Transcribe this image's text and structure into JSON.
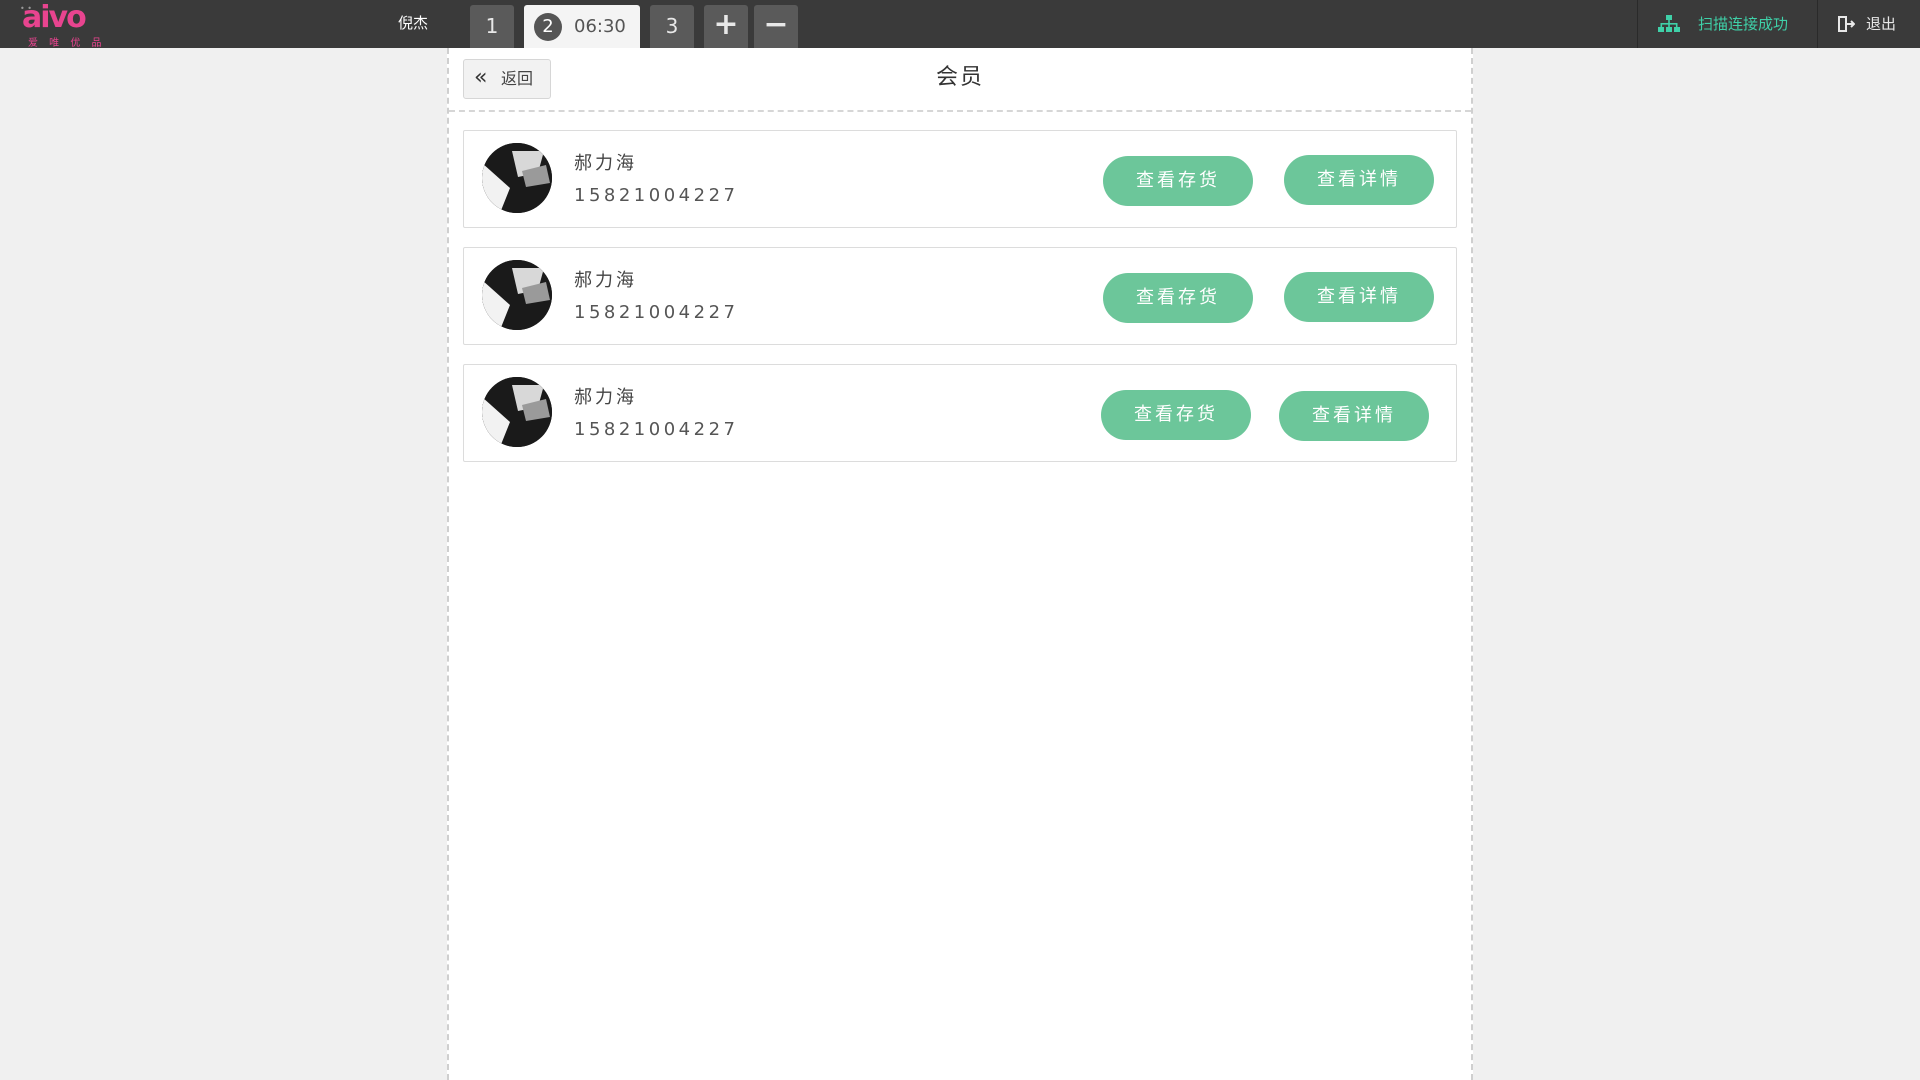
{
  "topbar": {
    "logo_text": "aivo",
    "logo_sub": "爱 唯 优 品",
    "username": "倪杰",
    "tabs": [
      {
        "label": "1"
      },
      {
        "label": "2",
        "time": "06:30"
      },
      {
        "label": "3"
      }
    ],
    "add_label": "+",
    "remove_label": "−",
    "scan_status": "扫描连接成功",
    "logout_label": "退出"
  },
  "page": {
    "back_label": "返回",
    "title": "会员"
  },
  "members": [
    {
      "name": "郝力海",
      "phone": "15821004227",
      "stock_button": "查看存货",
      "detail_button": "查看详情"
    },
    {
      "name": "郝力海",
      "phone": "15821004227",
      "stock_button": "查看存货",
      "detail_button": "查看详情"
    },
    {
      "name": "郝力海",
      "phone": "15821004227",
      "stock_button": "查看存货",
      "detail_button": "查看详情"
    }
  ],
  "colors": {
    "topbar": "#3a3a3a",
    "accent_green": "#6cc69a",
    "scan_status": "#3fd0a8",
    "logo_pink": "#e8448f"
  },
  "icons": {
    "back": "double-chevron-left-icon",
    "scan": "network-icon",
    "logout": "exit-door-icon"
  }
}
